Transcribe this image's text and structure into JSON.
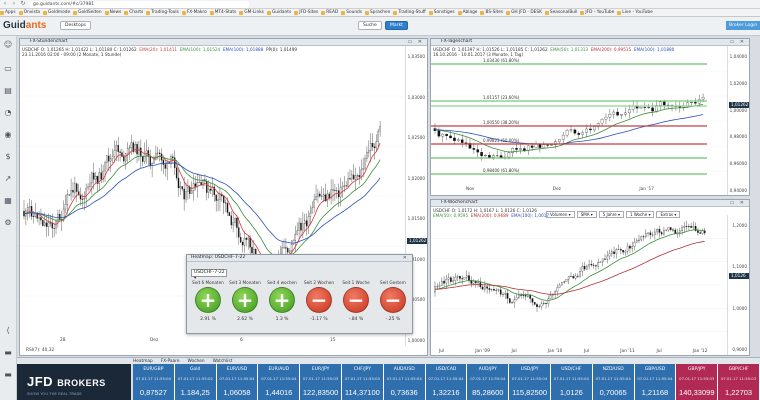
{
  "browser": {
    "url": "go.guidants.com/#c/37981",
    "bookmarks": [
      "Apps",
      "Onvista",
      "Goldmode",
      "GoldSeiten",
      "News",
      "Charts",
      "Trading-Tools",
      "FX-Makro",
      "MT4-Stats",
      "GM-Links",
      "Guidants",
      "JFD-Sites",
      "READ",
      "Sounds",
      "Sprachen",
      "Trading-Stuff",
      "Sonstiges",
      "Ablage",
      "BS-Sites",
      "GH JFD - DESK",
      "SeasonalBull",
      "JFD - YouTube",
      "Live - YouTube"
    ]
  },
  "app": {
    "logo_main": "Guid",
    "logo_accent": "ants",
    "desktop_label": "Desktops",
    "search_label": "Suche",
    "markt_label": "Markt",
    "user_label": "Broker Login"
  },
  "hourly": {
    "title": "FX-Stundenchart",
    "info1": "USDCHF  O: 1,01265  H: 1,01422  L: 1,01180  C: 1,01262",
    "ema20": "EMA(20): 1,01411",
    "ema50": "EMA(100): 1,01524",
    "ema100": "EMA(100): 1,01888",
    "pp": "PP(0): 1,01499",
    "info2": "23.11.2016 02:00 - 09:00  (2 Monate, 1 Stunde)",
    "yticks": [
      "1,03500",
      "1,03000",
      "1,02500",
      "1,02000",
      "1,01500",
      "1,01000",
      "1,00500",
      "1,00000"
    ],
    "last_price": "1,01262",
    "xticks": [
      "28",
      "Dez",
      "6",
      "15"
    ],
    "rsi_label": "RSI(7): 40,32"
  },
  "daily": {
    "title": "FX-Tageschart",
    "info1": "USDCHF  O: 1,01397  H: 1,01526  L: 1,01185  C: 1,01262",
    "ema50": "EMA(50): 1,01313",
    "ema200": "EMA(200): 0,99515",
    "ema100": "EMA(100): 1,01880",
    "info2": "16.10.2016 - 10.01.2017  (3 Monate, 1 Tag)",
    "levels": [
      "1,03430 (61,80%)",
      "1,01157 (23,60%)",
      "1,00550 (38,20%)",
      "0,99823 (50,00%)",
      "0,98400 (61,80%)"
    ],
    "yticks": [
      "1,04000",
      "1,02000",
      "1,00000",
      "0,98000",
      "0,96000",
      "0,94000"
    ],
    "last_price": "1,01262",
    "xticks": [
      "Nov",
      "Dez",
      "Jan '17"
    ]
  },
  "weekly": {
    "title": "FX-Wochenchart",
    "info1": "USDCHF  O: 1,0172  H: 1,0167  L: 1,0126  C: 1,0126",
    "ema50": "EMA(50): 0,9595",
    "ema200": "EMA(200): 0,9689",
    "ema100": "EMA(100): 1,0017",
    "info2": "28.04.2008 - 04.06.2012  (4 Jahre, 1 Woche)",
    "toolbar": [
      "Volumen",
      "SMA",
      "5 Jahre",
      "1 Woche",
      "Extras"
    ],
    "yticks": [
      "1,2000",
      "1,1000",
      "1,0000",
      "0,9000"
    ],
    "last_price": "1,0126",
    "xticks": [
      "Jul",
      "Jan '09",
      "Jul",
      "Jan '10",
      "Jul",
      "Jan '11",
      "Jul",
      "Jan '12"
    ]
  },
  "heatmap_popup": {
    "title": "Heatmap: USDCHF-7-22",
    "pair_select": "USDCHF-7-22",
    "periods": [
      {
        "label": "Seit 6 Monaten",
        "direction": "up",
        "symbol": "+",
        "pct": "2.91 %"
      },
      {
        "label": "Seit 3 Monaten",
        "direction": "up",
        "symbol": "+",
        "pct": "2.62 %"
      },
      {
        "label": "Seit 4 wochen",
        "direction": "up",
        "symbol": "+",
        "pct": "1.3 %"
      },
      {
        "label": "Seit 2 Wochen",
        "direction": "down",
        "symbol": "−",
        "pct": "-1.17 %"
      },
      {
        "label": "Seit 1 Woche",
        "direction": "down",
        "symbol": "−",
        "pct": "-.84 %"
      },
      {
        "label": "Seit Gestern",
        "direction": "down",
        "symbol": "−",
        "pct": "-.25 %"
      }
    ]
  },
  "bottom": {
    "heatbar_items": [
      "Heatmap",
      "FX-Paare",
      "Wochen",
      "Watchlist"
    ],
    "broker_name": "JFD",
    "broker_suffix": "BROKERS",
    "broker_tag": "SHOW YOU THE REAL TRADE",
    "tiles": [
      {
        "pair": "EUR/GBP",
        "sub": "07.01.17  11:55:04",
        "price": "0,87527",
        "color": "#2f6fae"
      },
      {
        "pair": "Gold",
        "sub": "07.01.17  11:55:02",
        "price": "1.184,25",
        "color": "#2f6fae"
      },
      {
        "pair": "EUR/USD",
        "sub": "07.01.17  11:55:04",
        "price": "1,06058",
        "color": "#2f6fae"
      },
      {
        "pair": "EUR/AUD",
        "sub": "07.01.17  11:55:04",
        "price": "1,44016",
        "color": "#2f6fae"
      },
      {
        "pair": "EUR/JPY",
        "sub": "07.01.17  11:55:03",
        "price": "122,83500",
        "color": "#2f6fae"
      },
      {
        "pair": "CHF/JPY",
        "sub": "07.01.17  11:55:03",
        "price": "114,37100",
        "color": "#2f6fae"
      },
      {
        "pair": "AUD/USD",
        "sub": "07.01.17  11:55:04",
        "price": "0,73636",
        "color": "#2f6fae"
      },
      {
        "pair": "USD/CAD",
        "sub": "07.01.17  11:55:04",
        "price": "1,32216",
        "color": "#2f6fae"
      },
      {
        "pair": "AUD/JPY",
        "sub": "07.01.17  11:55:04",
        "price": "85,28600",
        "color": "#2f6fae"
      },
      {
        "pair": "USD/JPY",
        "sub": "07.01.17  11:55:04",
        "price": "115,82500",
        "color": "#2f6fae"
      },
      {
        "pair": "USD/CHF",
        "sub": "07.01.17  11:55:04",
        "price": "1,0126",
        "color": "#2f6fae"
      },
      {
        "pair": "NZD/USD",
        "sub": "07.01.17  11:55:04",
        "price": "0,70065",
        "color": "#2f6fae"
      },
      {
        "pair": "GBP/USD",
        "sub": "07.01.17  11:55:04",
        "price": "1,21168",
        "color": "#2f6fae"
      },
      {
        "pair": "GBP/JPY",
        "sub": "07.01.17  11:55:03",
        "price": "140,33099",
        "color": "#b02a55"
      },
      {
        "pair": "GBP/CHF",
        "sub": "07.01.17  11:55:03",
        "price": "1,22703",
        "color": "#b02a55"
      }
    ]
  }
}
